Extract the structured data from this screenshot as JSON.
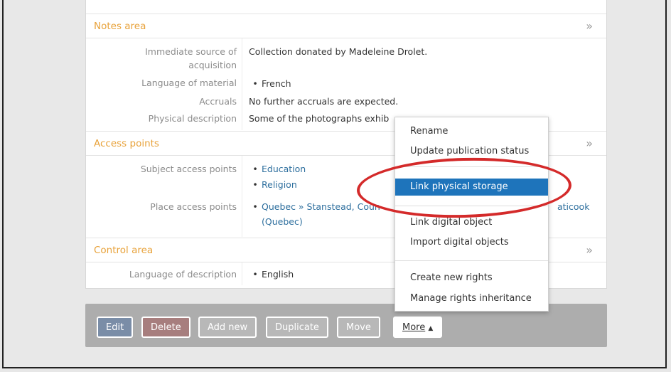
{
  "notes": {
    "title": "Notes area",
    "rows": [
      {
        "label": "Immediate source of acquisition",
        "value": "Collection donated by Madeleine Drolet."
      },
      {
        "label": "Language of material",
        "value": "French"
      },
      {
        "label": "Accruals",
        "value": "No further accruals are expected."
      },
      {
        "label": "Physical description",
        "value": "Some of the photographs exhib"
      }
    ]
  },
  "access": {
    "title": "Access points",
    "subject_label": "Subject access points",
    "subjects": [
      "Education",
      "Religion"
    ],
    "place_label": "Place access points",
    "place_value_start": "Quebec » Stanstead, Coun",
    "place_value_end": "aticook",
    "place_value_line2": "(Quebec)"
  },
  "control": {
    "title": "Control area",
    "lang_label": "Language of description",
    "lang_value": "English"
  },
  "chevron": "»",
  "bullet": "•",
  "actions": {
    "edit": "Edit",
    "delete": "Delete",
    "add_new": "Add new",
    "duplicate": "Duplicate",
    "move": "Move",
    "more": "More",
    "more_caret": "▲"
  },
  "menu": {
    "items": [
      "Rename",
      "Update publication status",
      "Link physical storage",
      "Link digital object",
      "Import digital objects",
      "Create new rights",
      "Manage rights inheritance"
    ],
    "active_index": 2
  },
  "colors": {
    "section_title": "#e8a23a",
    "link": "#2e6f9e",
    "menu_active": "#1e74bb",
    "annotation_ellipse": "#d42a2a"
  }
}
